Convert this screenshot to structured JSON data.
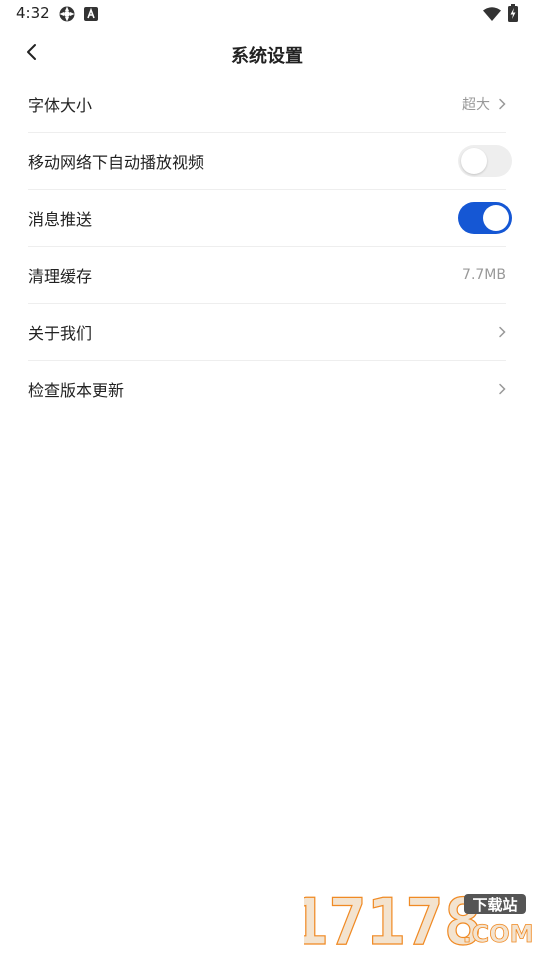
{
  "status_bar": {
    "time": "4:32",
    "icons": [
      "settings-gear-icon",
      "a-badge-icon",
      "wifi-icon",
      "battery-charging-icon"
    ]
  },
  "header": {
    "title": "系统设置",
    "back_icon": "chevron-left-icon"
  },
  "settings": {
    "font_size": {
      "label": "字体大小",
      "value": "超大"
    },
    "autoplay_mobile": {
      "label": "移动网络下自动播放视频",
      "enabled": false
    },
    "push": {
      "label": "消息推送",
      "enabled": true
    },
    "cache": {
      "label": "清理缓存",
      "value": "7.7MB"
    },
    "about": {
      "label": "关于我们"
    },
    "update": {
      "label": "检查版本更新"
    }
  },
  "watermark": {
    "number": "17178",
    "tag": "下载站",
    "suffix": ".COM"
  },
  "colors": {
    "accent": "#1557d4",
    "toggle_off": "#eeeeee",
    "secondary_text": "#999999",
    "divider": "#eeeeee",
    "watermark_orange": "#f08a24"
  }
}
